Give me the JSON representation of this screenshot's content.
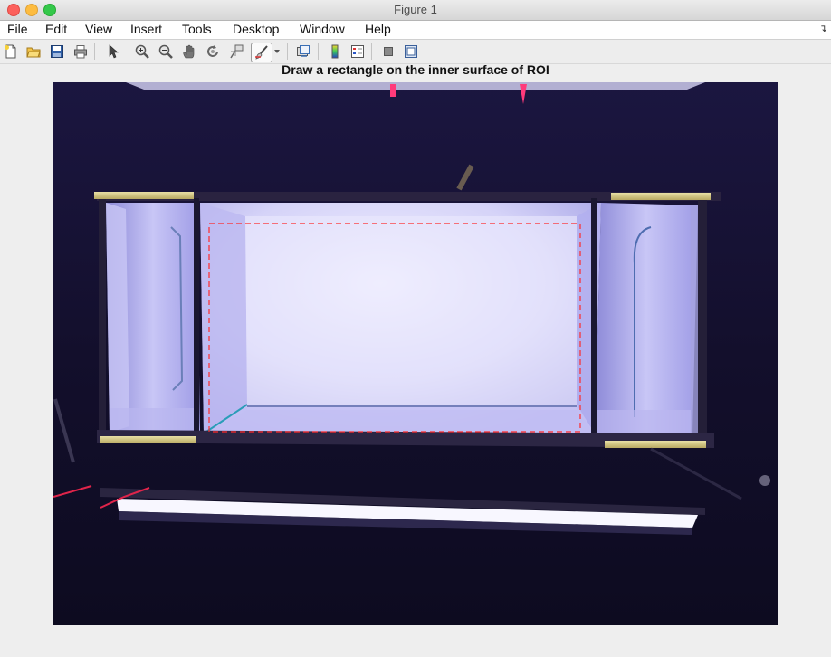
{
  "window": {
    "title": "Figure 1"
  },
  "menu": {
    "items": [
      "File",
      "Edit",
      "View",
      "Insert",
      "Tools",
      "Desktop",
      "Window",
      "Help"
    ],
    "overflow_icon": "curved-arrow-icon"
  },
  "toolbar": {
    "buttons": [
      "new-figure-icon",
      "open-file-icon",
      "save-icon",
      "print-icon",
      "edit-plot-pointer-icon",
      "zoom-in-icon",
      "zoom-out-icon",
      "pan-hand-icon",
      "rotate-3d-icon",
      "data-cursor-icon",
      "brush-icon",
      "brush-dropdown-icon",
      "link-plot-icon",
      "insert-colorbar-icon",
      "insert-legend-icon",
      "hide-plot-tools-icon",
      "show-plot-tools-icon"
    ]
  },
  "axes": {
    "title": "Draw a rectangle on the inner surface of ROI"
  },
  "roi": {
    "color": "#ff2a2a",
    "style": "dashed"
  },
  "colors": {
    "window_bg": "#eeeeee",
    "image_dark": "#120f27",
    "tank_glow": "#d8d6fa",
    "tape": "#d4c98a",
    "roi_line": "#ff2a2a"
  }
}
